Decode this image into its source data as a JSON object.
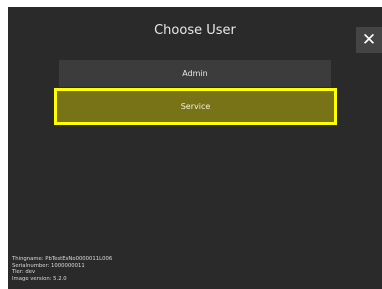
{
  "dialog": {
    "title": "Choose User",
    "close_label": "✕"
  },
  "users": [
    {
      "label": "Admin",
      "selected": false
    },
    {
      "label": "Service",
      "selected": true
    }
  ],
  "device_info": {
    "thingname": "Thingname: PbTestEsNo0000011L006",
    "serialnumber": "Serialnumber: 1000000011",
    "tier": "Tier: dev",
    "image_version": "Image version: 5.2.0"
  },
  "colors": {
    "dialog_background": "#2a2a2a",
    "selected_background": "#787316",
    "selected_border": "#ffff00"
  }
}
